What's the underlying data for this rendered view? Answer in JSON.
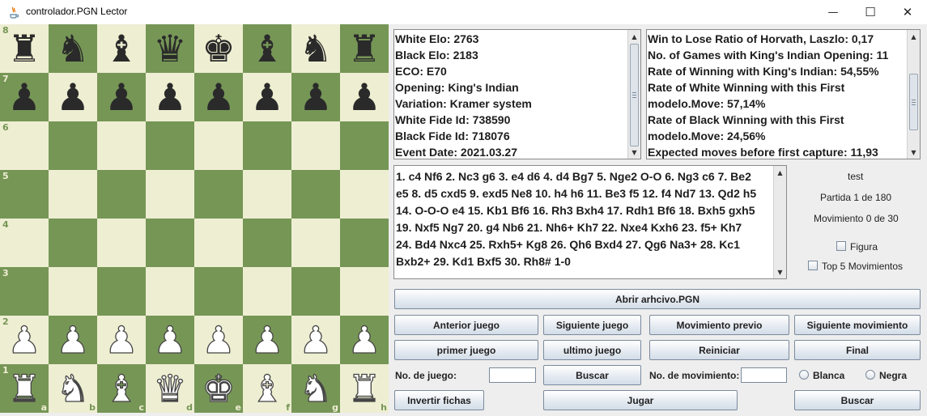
{
  "window": {
    "title": "controlador.PGN Lector",
    "minimize_glyph": "—",
    "maximize_glyph": "☐",
    "close_glyph": "✕"
  },
  "board": {
    "ranks": [
      "8",
      "7",
      "6",
      "5",
      "4",
      "3",
      "2",
      "1"
    ],
    "files": [
      "a",
      "b",
      "c",
      "d",
      "e",
      "f",
      "g",
      "h"
    ],
    "pieces": [
      [
        "♜",
        "♞",
        "♝",
        "♛",
        "♚",
        "♝",
        "♞",
        "♜"
      ],
      [
        "♟",
        "♟",
        "♟",
        "♟",
        "♟",
        "♟",
        "♟",
        "♟"
      ],
      [
        "",
        "",
        "",
        "",
        "",
        "",
        "",
        ""
      ],
      [
        "",
        "",
        "",
        "",
        "",
        "",
        "",
        ""
      ],
      [
        "",
        "",
        "",
        "",
        "",
        "",
        "",
        ""
      ],
      [
        "",
        "",
        "",
        "",
        "",
        "",
        "",
        ""
      ],
      [
        "♟",
        "♟",
        "♟",
        "♟",
        "♟",
        "♟",
        "♟",
        "♟"
      ],
      [
        "♜",
        "♞",
        "♝",
        "♛",
        "♚",
        "♝",
        "♞",
        "♜"
      ]
    ],
    "colors": {
      "light": "#eeeed2",
      "dark": "#769656"
    }
  },
  "game_info": [
    "White Elo:   2763",
    "Black Elo:   2183",
    "ECO:   E70",
    "Opening:   King's Indian",
    "Variation:   Kramer system",
    "White Fide Id:   738590",
    "Black Fide Id:   718076",
    "Event Date:   2021.03.27"
  ],
  "stats": [
    "Win to Lose Ratio of Horvath, Laszlo:  0,17",
    "No. of Games with King's Indian Opening:  11",
    "Rate of Winning with King's Indian:  54,55%",
    "Rate of White Winning with this First",
    "modelo.Move:  57,14%",
    "Rate of Black Winning with this First",
    "modelo.Move:  24,56%",
    "Expected moves before first capture:  11,93"
  ],
  "moves_text": "1. c4 Nf6 2. Nc3 g6 3. e4 d6 4. d4 Bg7 5. Nge2 O-O 6. Ng3 c6 7. Be2 e5 8. d5 cxd5 9. exd5 Ne8 10. h4 h6 11. Be3 f5 12. f4 Nd7 13. Qd2 h5 14. O-O-O e4 15. Kb1 Bf6 16. Rh3 Bxh4 17. Rdh1 Bf6 18. Bxh5 gxh5 19. Nxf5 Ng7 20. g4 Nb6 21. Nh6+ Kh7 22. Nxe4 Kxh6 23. f5+ Kh7 24. Bd4 Nxc4 25. Rxh5+ Kg8 26. Qh6 Bxd4 27. Qg6 Na3+ 28. Kc1 Bxb2+ 29. Kd1 Bxf5 30. Rh8# 1-0",
  "side": {
    "name": "test",
    "partida": "Partida 1 de 180",
    "movimiento": "Movimiento 0 de 30",
    "figura_label": "Figura",
    "top5_label": "Top 5 Movimientos"
  },
  "buttons": {
    "open_pgn": "Abrir arhcivo.PGN",
    "prev_game": "Anterior juego",
    "next_game": "Siguiente juego",
    "prev_move": "Movimiento previo",
    "next_move": "Siguiente movimiento",
    "first_game": "primer juego",
    "last_game": "ultimo juego",
    "reset": "Reiniciar",
    "final": "Final",
    "search_game": "Buscar",
    "invert": "Invertir fichas",
    "play": "Jugar",
    "search_move": "Buscar"
  },
  "labels": {
    "game_no": "No. de juego:",
    "move_no": "No. de movimiento:",
    "white_radio": "Blanca",
    "black_radio": "Negra"
  }
}
